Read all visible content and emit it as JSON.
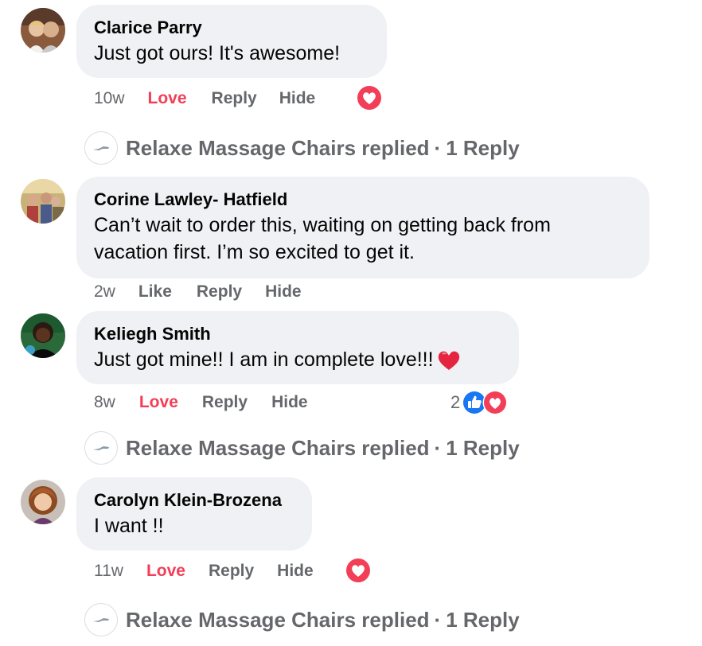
{
  "comments": [
    {
      "author": "Clarice Parry",
      "text": "Just got ours! It's awesome!",
      "time": "10w",
      "reaction_action": "Love",
      "reply_label": "Reply",
      "hide_label": "Hide",
      "reactions": [
        "love-icon"
      ]
    },
    {
      "author": "Corine Lawley- Hatfield",
      "text_lines": [
        "Can’t wait to order this, waiting on getting back from",
        "vacation first. I’m so excited to get it."
      ],
      "time": "2w",
      "reaction_action": "Like",
      "reply_label": "Reply",
      "hide_label": "Hide",
      "reactions": []
    },
    {
      "author": "Keliegh Smith",
      "text": "Just got mine!! I am in complete love!!!",
      "text_emoji": "red-heart-emoji",
      "time": "8w",
      "reaction_action": "Love",
      "reply_label": "Reply",
      "hide_label": "Hide",
      "reaction_count": "2",
      "reactions": [
        "like-icon",
        "love-icon"
      ]
    },
    {
      "author": "Carolyn Klein-Brozena",
      "text": "I want !!",
      "time": "11w",
      "reaction_action": "Love",
      "reply_label": "Reply",
      "hide_label": "Hide",
      "reactions": [
        "love-icon"
      ]
    }
  ],
  "reply_threads": [
    {
      "page_name": "Relaxe Massage Chairs",
      "verb": "replied",
      "separator": "·",
      "count_label": "1 Reply"
    },
    {
      "page_name": "Relaxe Massage Chairs",
      "verb": "replied",
      "separator": "·",
      "count_label": "1 Reply"
    },
    {
      "page_name": "Relaxe Massage Chairs",
      "verb": "replied",
      "separator": "·",
      "count_label": "1 Reply"
    }
  ],
  "colors": {
    "bubble": "#eff1f4",
    "secondary_text": "#65676b",
    "love": "#f33e58",
    "like": "#1877f2"
  }
}
